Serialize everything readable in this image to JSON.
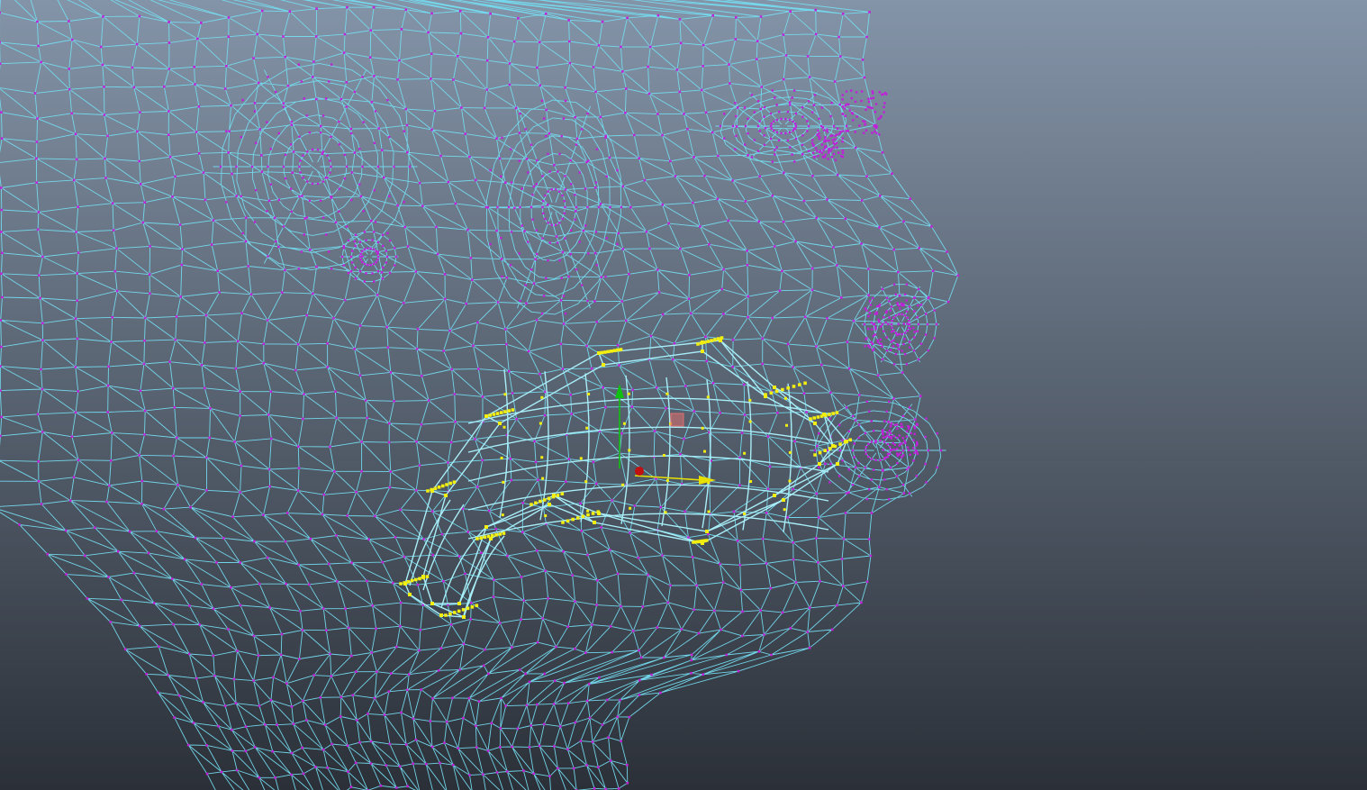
{
  "viewport": {
    "background_top": "#8494a8",
    "background_bottom": "#2b3038",
    "display_mode": "wireframe",
    "component_mode": "vertex"
  },
  "mesh": {
    "object": "head",
    "wire_color": "#74dcf0",
    "vertex_color": "#c021d8"
  },
  "selection": {
    "region": "mouth-interior",
    "wire_color": "#a8eef8",
    "vertex_color": "#f2ee10"
  },
  "manipulator": {
    "tool": "move",
    "x_axis_color": "#e8e000",
    "y_axis_color": "#10c010",
    "z_axis_color": "#c01010",
    "center_color": "#e07070"
  }
}
